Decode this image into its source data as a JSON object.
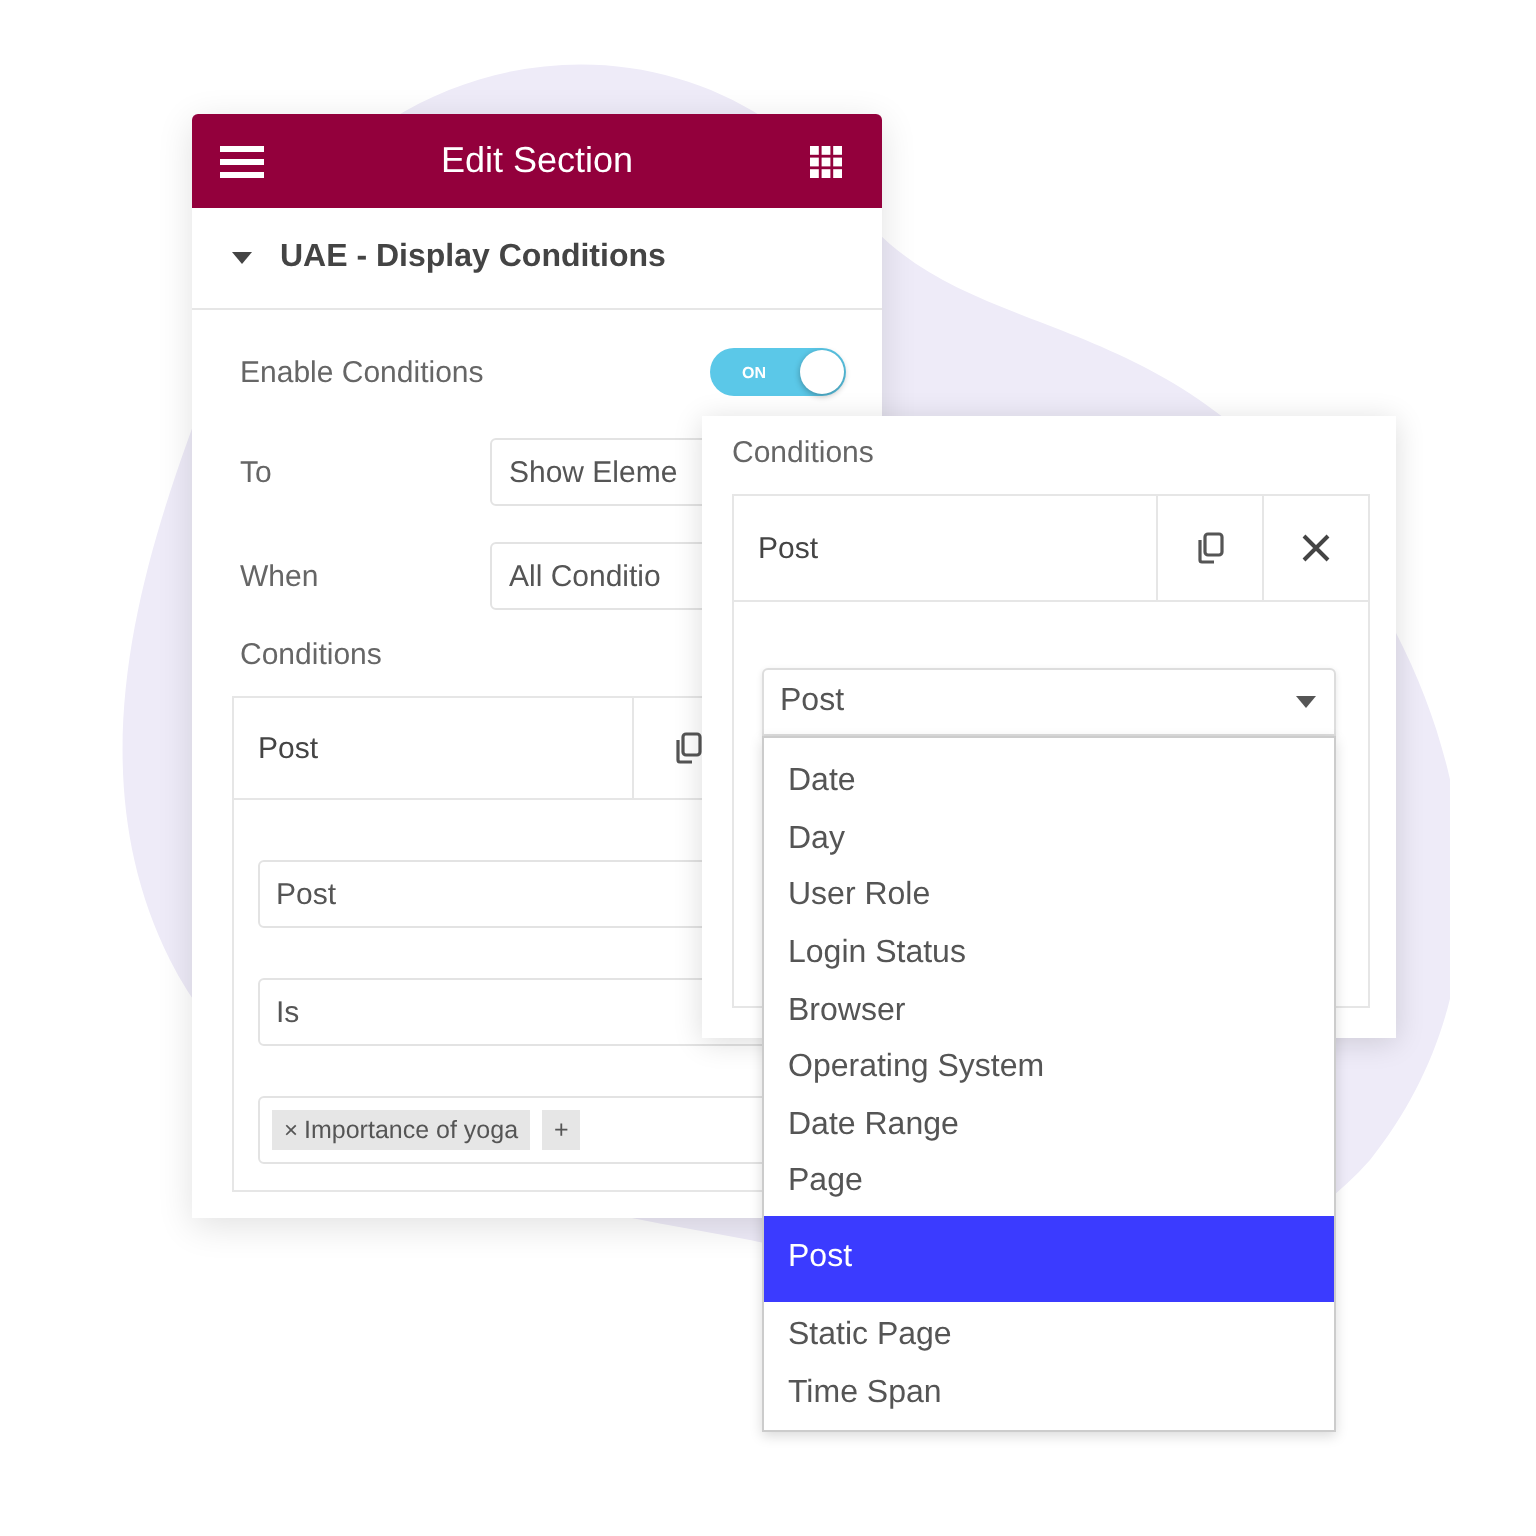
{
  "back_panel": {
    "header": {
      "title": "Edit Section"
    },
    "section": {
      "title": "UAE - Display Conditions",
      "expanded": true
    },
    "enable": {
      "label": "Enable Conditions",
      "on": true,
      "switch_text": "ON"
    },
    "fields": [
      {
        "label": "To",
        "value": "Show Eleme"
      },
      {
        "label": "When",
        "value": "All Conditio"
      }
    ],
    "conditions_label": "Conditions",
    "repeater": {
      "title": "Post",
      "selects": [
        "Post",
        "Is"
      ],
      "tags": [
        {
          "remove": "×",
          "label": "Importance of yoga"
        }
      ],
      "add": "+"
    }
  },
  "front_panel": {
    "label": "Conditions",
    "repeater": {
      "title": "Post"
    },
    "select": {
      "value": "Post",
      "expanded": true
    },
    "options": [
      {
        "label": "Date",
        "selected": false
      },
      {
        "label": "Day",
        "selected": false
      },
      {
        "label": "User Role",
        "selected": false
      },
      {
        "label": "Login Status",
        "selected": false
      },
      {
        "label": "Browser",
        "selected": false
      },
      {
        "label": "Operating System",
        "selected": false
      },
      {
        "label": "Date Range",
        "selected": false
      },
      {
        "label": "Page",
        "selected": false
      },
      {
        "label": "Post",
        "selected": true
      },
      {
        "label": "Static Page",
        "selected": false
      },
      {
        "label": "Time Span",
        "selected": false
      }
    ]
  }
}
